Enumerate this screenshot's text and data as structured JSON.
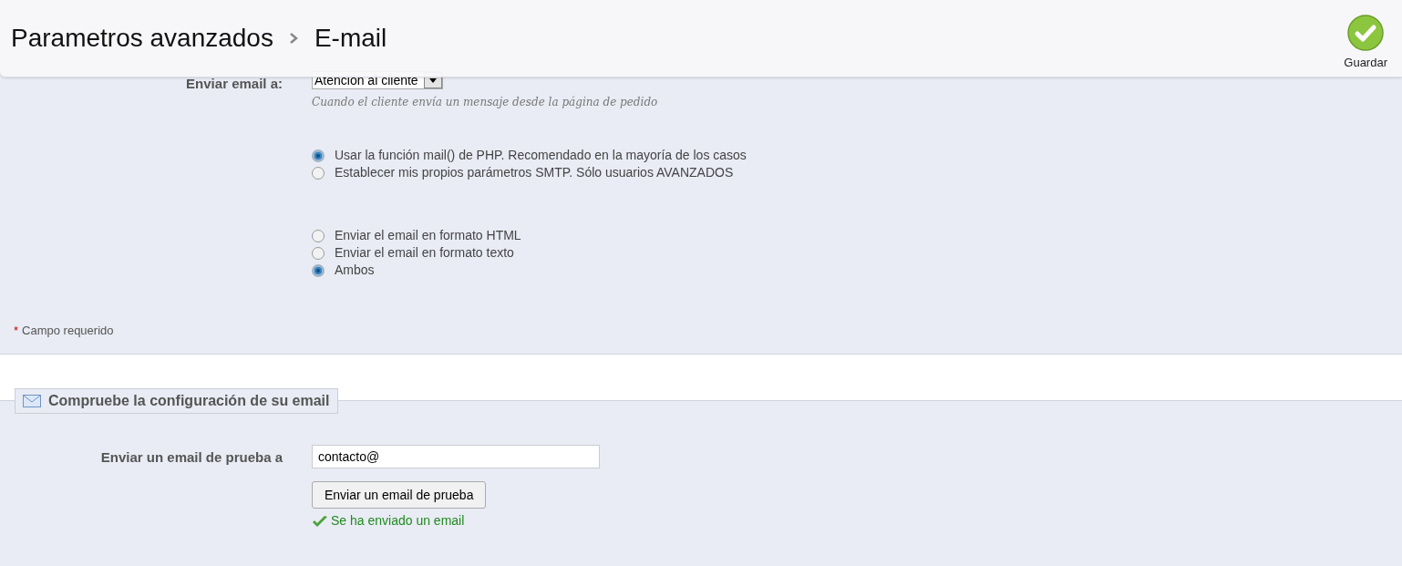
{
  "header": {
    "breadcrumb": [
      "Parametros avanzados",
      "E-mail"
    ],
    "save_button": "Guardar"
  },
  "email_section": {
    "send_to": {
      "label": "Enviar email a:",
      "value": "Atención al cliente",
      "hint": "Cuando el cliente envía un mensaje desde la página de pedido"
    },
    "method_options": [
      {
        "label": "Usar la función mail() de PHP. Recomendado en la mayoría de los casos",
        "selected": true
      },
      {
        "label": "Establecer mis propios parámetros SMTP. Sólo usuarios AVANZADOS",
        "selected": false
      }
    ],
    "format_options": [
      {
        "label": "Enviar el email en formato HTML",
        "selected": false
      },
      {
        "label": "Enviar el email en formato texto",
        "selected": false
      },
      {
        "label": "Ambos",
        "selected": true
      }
    ],
    "required_note": {
      "mark": "*",
      "text": "Campo requerido"
    }
  },
  "test_section": {
    "legend": "Compruebe la configuración de su email",
    "label": "Enviar un email de prueba a",
    "value": "contacto@",
    "button": "Enviar un email de prueba",
    "success": "Se ha enviado un email"
  }
}
